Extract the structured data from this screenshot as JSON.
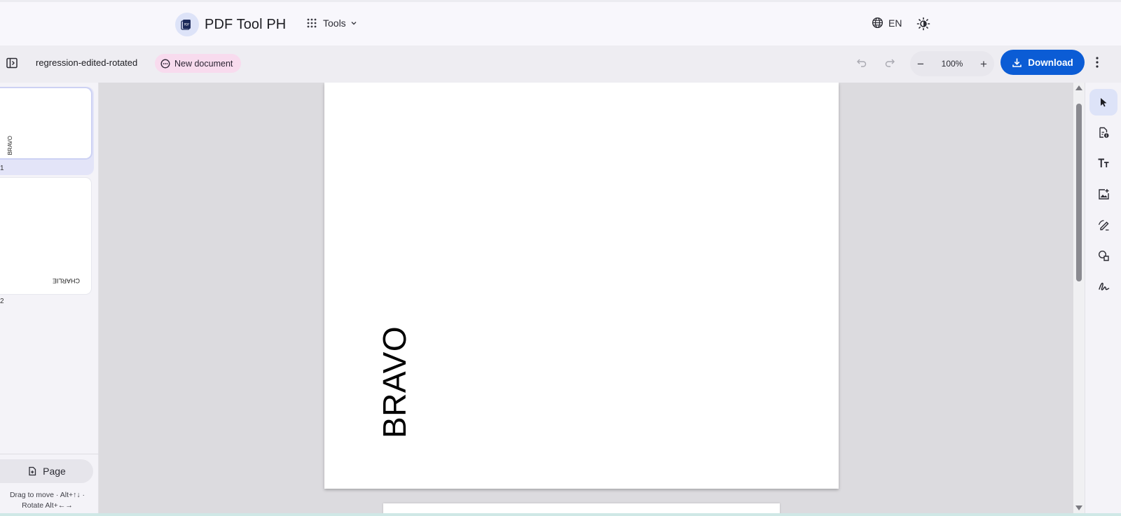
{
  "header": {
    "brand_title": "PDF Tool PH",
    "logo_text": "PDF",
    "tools_label": "Tools",
    "language_label": "EN"
  },
  "toolbar": {
    "document_name": "regression-edited-rotated",
    "status_badge": "New document",
    "zoom_label": "100%",
    "zoom_out_label": "−",
    "zoom_in_label": "+",
    "download_label": "Download"
  },
  "sidebar": {
    "pages": [
      {
        "number": "1",
        "thumbnail_text": "BRAVO",
        "rotation": "90° counter-clockwise",
        "selected": true
      },
      {
        "number": "2",
        "thumbnail_text": "CHARLIE",
        "rotation": "180°",
        "selected": false
      }
    ],
    "add_page_label": "Page",
    "hint_line1": "Drag to move · Alt+↑↓ ·",
    "hint_line2": "Rotate Alt+←→"
  },
  "canvas": {
    "page1_text": "BRAVO"
  },
  "right_rail": {
    "tools": [
      {
        "name": "select-tool",
        "icon": "cursor-arrow-icon",
        "active": true
      },
      {
        "name": "page-info-tool",
        "icon": "document-info-icon",
        "active": false
      },
      {
        "name": "text-tool",
        "icon": "text-size-icon",
        "active": false
      },
      {
        "name": "image-tool",
        "icon": "image-add-icon",
        "active": false
      },
      {
        "name": "draw-tool",
        "icon": "pen-draw-icon",
        "active": false
      },
      {
        "name": "shapes-tool",
        "icon": "shapes-icon",
        "active": false
      },
      {
        "name": "signature-tool",
        "icon": "signature-icon",
        "active": false
      }
    ]
  },
  "colors": {
    "accent": "#0b5cd5",
    "badge_bg": "#f8dbee",
    "selected_bg": "#e3e4f8"
  }
}
